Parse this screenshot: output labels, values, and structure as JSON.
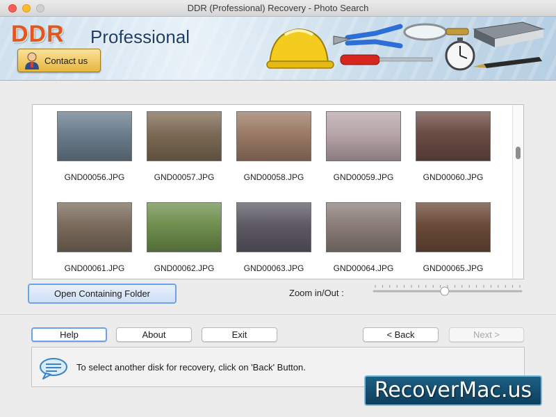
{
  "window": {
    "title": "DDR (Professional) Recovery - Photo Search"
  },
  "banner": {
    "brand_main": "DDR",
    "brand_sub": "Professional",
    "contact_label": "Contact us"
  },
  "gallery": {
    "items": [
      {
        "name": "GND00056.JPG",
        "color": "#6a7d8c"
      },
      {
        "name": "GND00057.JPG",
        "color": "#7d6a55"
      },
      {
        "name": "GND00058.JPG",
        "color": "#9b7a66"
      },
      {
        "name": "GND00059.JPG",
        "color": "#b7a5a9"
      },
      {
        "name": "GND00060.JPG",
        "color": "#6b4c44"
      },
      {
        "name": "GND00061.JPG",
        "color": "#7a6b5c"
      },
      {
        "name": "GND00062.JPG",
        "color": "#6f8f4e"
      },
      {
        "name": "GND00063.JPG",
        "color": "#5d5a65"
      },
      {
        "name": "GND00064.JPG",
        "color": "#8a7d78"
      },
      {
        "name": "GND00065.JPG",
        "color": "#6b4a38"
      }
    ]
  },
  "controls": {
    "open_folder_label": "Open Containing Folder",
    "zoom_label": "Zoom in/Out :",
    "zoom_level": 0.48
  },
  "buttons": {
    "help": "Help",
    "about": "About",
    "exit": "Exit",
    "back": "< Back",
    "next": "Next >"
  },
  "status": {
    "message": "To select another disk for recovery, click on 'Back' Button."
  },
  "watermark": {
    "text": "RecoverMac.us"
  }
}
